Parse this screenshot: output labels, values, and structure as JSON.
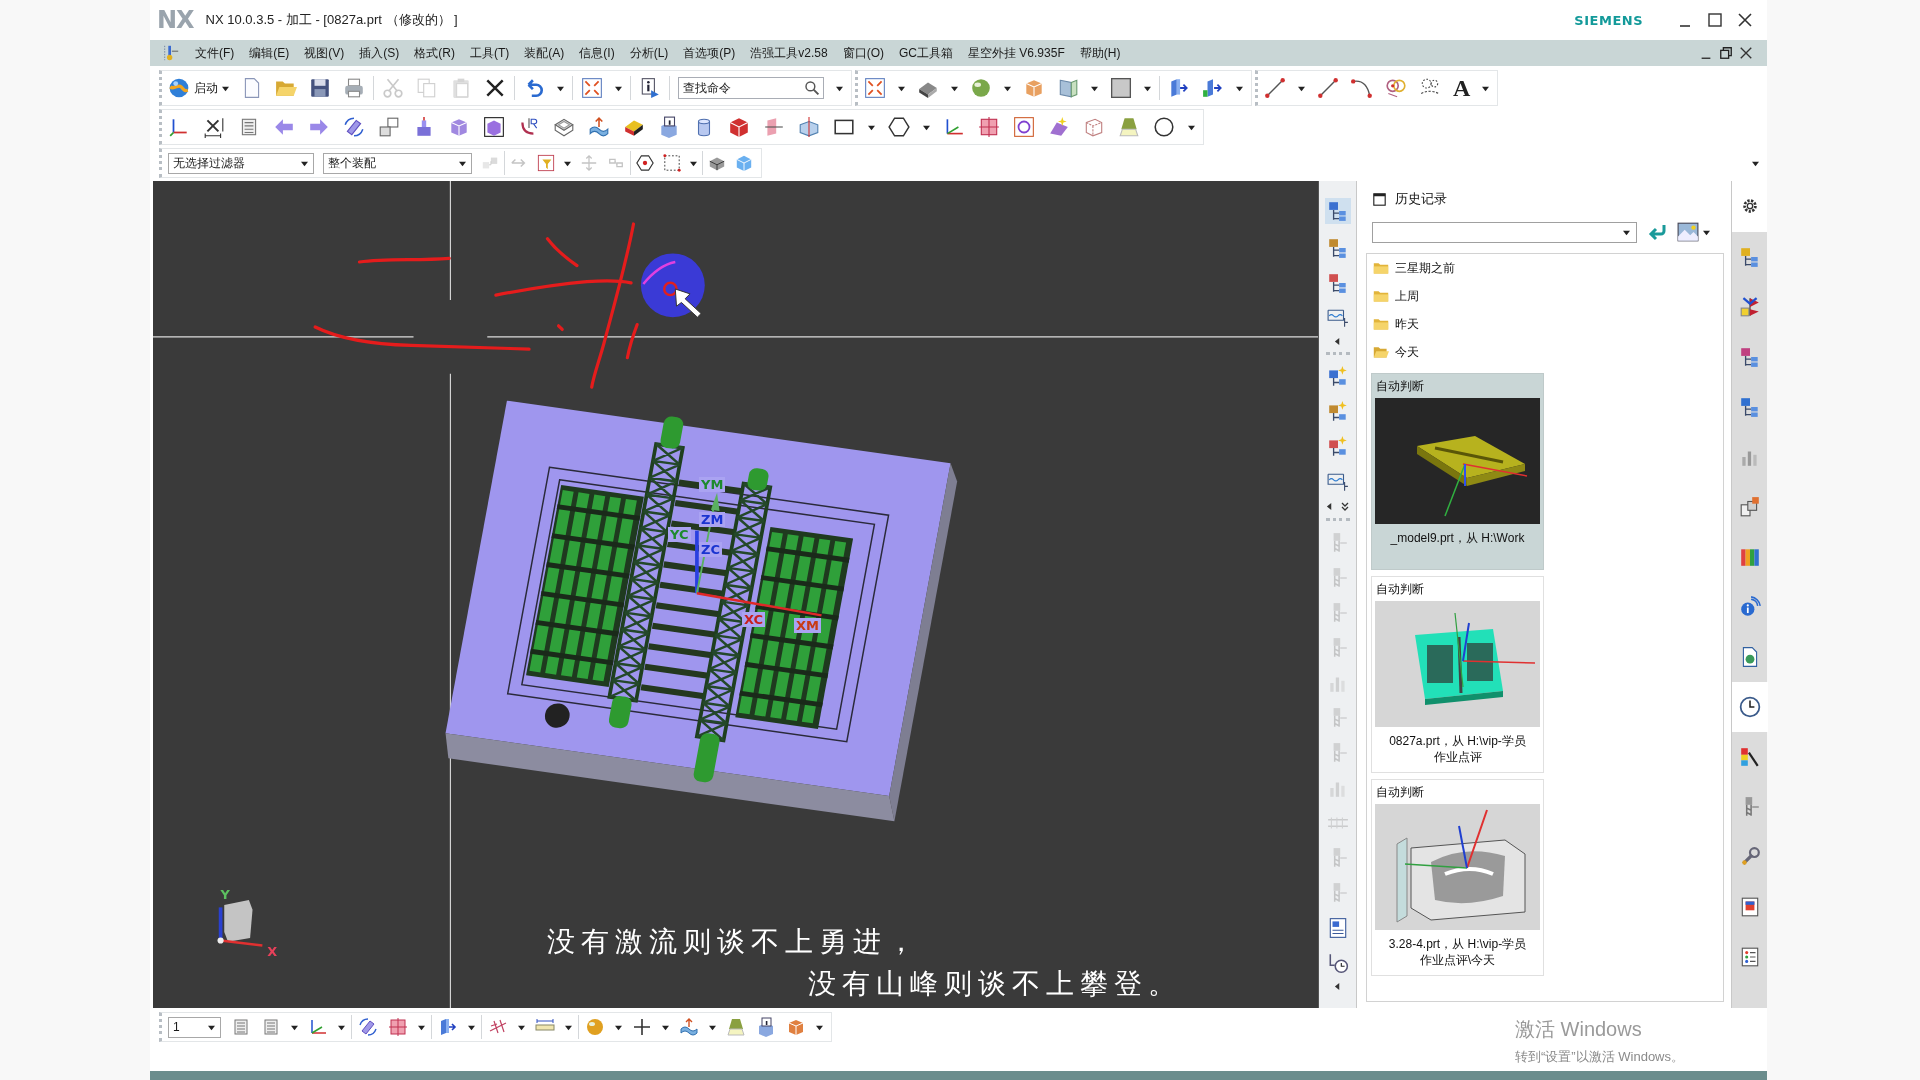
{
  "window": {
    "logo": "NX",
    "title": "NX 10.0.3.5 - 加工 - [0827a.prt （修改的） ]",
    "brand": "SIEMENS"
  },
  "menu_bar": [
    "文件(F)",
    "编辑(E)",
    "视图(V)",
    "插入(S)",
    "格式(R)",
    "工具(T)",
    "装配(A)",
    "信息(I)",
    "分析(L)",
    "首选项(P)",
    "浩强工具v2.58",
    "窗口(O)",
    "GC工具箱",
    "星空外挂 V6.935F",
    "帮助(H)"
  ],
  "standard_toolbar": {
    "start_label": "启动",
    "items": [
      {
        "disabled": false
      },
      {
        "disabled": false
      },
      {
        "disabled": false
      },
      {
        "disabled": false
      },
      {
        "disabled": true
      },
      {
        "disabled": true
      },
      {
        "disabled": true
      },
      {
        "disabled": false
      },
      {
        "disabled": false
      },
      {
        "disabled": false
      },
      {
        "disabled": false
      }
    ],
    "search": {
      "placeholder": "查找命令"
    }
  },
  "curve_toolbar": {
    "text_tool": "A"
  },
  "selection_bar": {
    "filter": "无选择过滤器",
    "scope": "整个装配",
    "items": [
      {
        "disabled": true
      },
      {
        "disabled": true
      },
      {
        "disabled": false
      },
      {
        "disabled": true
      },
      {
        "disabled": true
      },
      {
        "disabled": false
      },
      {
        "disabled": false
      },
      {
        "disabled": false
      },
      {
        "disabled": false
      }
    ]
  },
  "viewport": {
    "axis_labels": [
      "YM",
      "ZM",
      "YC",
      "ZC",
      "XC",
      "XM"
    ],
    "triad_labels": [
      {
        "text": "Y",
        "color": "#5cc060"
      },
      {
        "text": "X",
        "color": "#e8405a"
      }
    ],
    "subtitle": [
      "没有激流则谈不上勇进，",
      "没有山峰则谈不上攀登。"
    ]
  },
  "resource_bar": {
    "items": [
      {
        "selected": true,
        "disabled": false
      },
      {
        "selected": false,
        "disabled": false
      },
      {
        "selected": false,
        "disabled": false
      },
      {
        "selected": false,
        "disabled": false
      },
      {
        "selected": false,
        "disabled": false
      },
      {
        "selected": false,
        "disabled": false
      },
      {
        "selected": false,
        "disabled": false
      },
      {
        "selected": false,
        "disabled": false
      },
      {
        "selected": false,
        "disabled": true
      },
      {
        "selected": false,
        "disabled": true
      },
      {
        "selected": false,
        "disabled": true
      },
      {
        "selected": false,
        "disabled": true
      },
      {
        "selected": false,
        "disabled": true
      },
      {
        "selected": false,
        "disabled": true
      },
      {
        "selected": false,
        "disabled": true
      },
      {
        "selected": false,
        "disabled": true
      },
      {
        "selected": false,
        "disabled": true
      },
      {
        "selected": false,
        "disabled": true
      },
      {
        "selected": false,
        "disabled": true
      },
      {
        "selected": false,
        "disabled": false
      },
      {
        "selected": false,
        "disabled": false
      }
    ]
  },
  "history": {
    "title": "历史记录",
    "folders": [
      {
        "label": "三星期之前",
        "open": false
      },
      {
        "label": "上周",
        "open": false
      },
      {
        "label": "昨天",
        "open": false
      },
      {
        "label": "今天",
        "open": true
      }
    ],
    "entries": [
      {
        "label": "自动判断",
        "kind": "bar",
        "caption": [
          "_model9.prt，从 H:\\Work"
        ],
        "selected": true
      },
      {
        "label": "自动判断",
        "kind": "plate",
        "caption": [
          "0827a.prt，从 H:\\vip-学员",
          "作业点评"
        ],
        "selected": false
      },
      {
        "label": "自动判断",
        "kind": "cavity",
        "caption": [
          "3.28-4.prt，从 H:\\vip-学员",
          "作业点评\\今天"
        ],
        "selected": false
      }
    ]
  },
  "resource_tabs": [
    {
      "selected": false
    },
    {
      "selected": false
    },
    {
      "selected": false
    },
    {
      "selected": false
    },
    {
      "selected": false
    },
    {
      "selected": false
    },
    {
      "selected": false
    },
    {
      "selected": false
    },
    {
      "selected": false
    },
    {
      "selected": true
    },
    {
      "selected": false
    },
    {
      "selected": false
    },
    {
      "selected": false
    },
    {
      "selected": false
    },
    {
      "selected": false
    }
  ],
  "bottom_toolbar": {
    "layer": "1"
  },
  "activation_notice": {
    "title": "激活 Windows",
    "hint": "转到“设置”以激活 Windows。"
  }
}
